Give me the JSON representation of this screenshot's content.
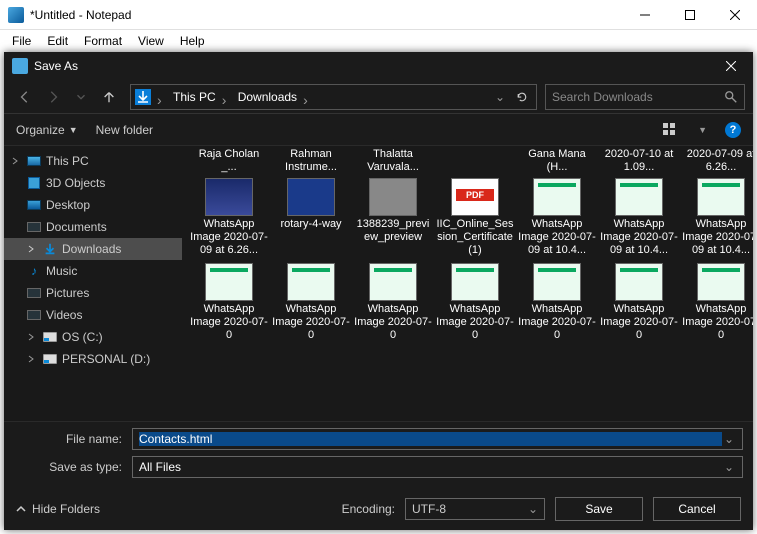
{
  "notepad": {
    "title": "*Untitled - Notepad",
    "menu": [
      "File",
      "Edit",
      "Format",
      "View",
      "Help"
    ]
  },
  "dialog": {
    "title": "Save As",
    "breadcrumb": {
      "seg1": "This PC",
      "seg2": "Downloads"
    },
    "search_placeholder": "Search Downloads",
    "toolbar": {
      "organize": "Organize",
      "newfolder": "New folder"
    },
    "tree": {
      "root": "This PC",
      "items": [
        {
          "label": "3D Objects"
        },
        {
          "label": "Desktop"
        },
        {
          "label": "Documents"
        },
        {
          "label": "Downloads"
        },
        {
          "label": "Music"
        },
        {
          "label": "Pictures"
        },
        {
          "label": "Videos"
        },
        {
          "label": "OS (C:)"
        },
        {
          "label": "PERSONAL (D:)"
        }
      ]
    },
    "files_row0": [
      {
        "label": "Raja Cholan _..."
      },
      {
        "label": "Rahman Instrume..."
      },
      {
        "label": "Thalatta Varuvala..."
      },
      {
        "label": ""
      },
      {
        "label": "Gana Mana (H..."
      },
      {
        "label": "2020-07-10 at 1.09..."
      },
      {
        "label": "2020-07-09 at 6.26..."
      }
    ],
    "files_row1": [
      {
        "label": "WhatsApp Image 2020-07-09 at 6.26..."
      },
      {
        "label": "rotary-4-way"
      },
      {
        "label": "1388239_preview_preview"
      },
      {
        "label": "IIC_Online_Session_Certificate (1)"
      },
      {
        "label": "WhatsApp Image 2020-07-09 at 10.4..."
      },
      {
        "label": "WhatsApp Image 2020-07-09 at 10.4..."
      },
      {
        "label": "WhatsApp Image 2020-07-09 at 10.4..."
      }
    ],
    "files_row2": [
      {
        "label": "WhatsApp Image 2020-07-0"
      },
      {
        "label": "WhatsApp Image 2020-07-0"
      },
      {
        "label": "WhatsApp Image 2020-07-0"
      },
      {
        "label": "WhatsApp Image 2020-07-0"
      },
      {
        "label": "WhatsApp Image 2020-07-0"
      },
      {
        "label": "WhatsApp Image 2020-07-0"
      },
      {
        "label": "WhatsApp Image 2020-07-0"
      }
    ],
    "filename_label": "File name:",
    "filename_value": "Contacts.html",
    "filetype_label": "Save as type:",
    "filetype_value": "All Files",
    "hide_folders": "Hide Folders",
    "encoding_label": "Encoding:",
    "encoding_value": "UTF-8",
    "save_btn": "Save",
    "cancel_btn": "Cancel"
  }
}
